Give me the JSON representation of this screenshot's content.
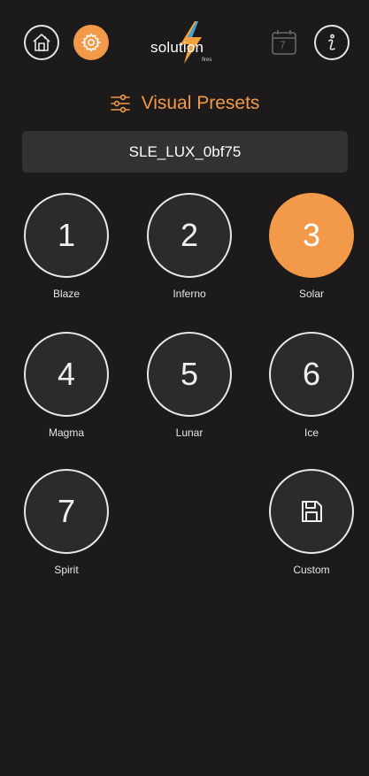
{
  "header": {
    "logo_text": "solution",
    "logo_sub": "fires",
    "icons": {
      "home": "home-icon",
      "settings": "gear-icon",
      "calendar": "calendar-icon",
      "info": "info-icon"
    },
    "calendar_day": "7"
  },
  "section": {
    "title": "Visual Presets",
    "icon": "sliders-icon"
  },
  "device": {
    "name": "SLE_LUX_0bf75"
  },
  "presets": [
    {
      "number": "1",
      "label": "Blaze",
      "active": false
    },
    {
      "number": "2",
      "label": "Inferno",
      "active": false
    },
    {
      "number": "3",
      "label": "Solar",
      "active": true
    },
    {
      "number": "4",
      "label": "Magma",
      "active": false
    },
    {
      "number": "5",
      "label": "Lunar",
      "active": false
    },
    {
      "number": "6",
      "label": "Ice",
      "active": false
    },
    {
      "number": "7",
      "label": "Spirit",
      "active": false
    }
  ],
  "custom": {
    "label": "Custom",
    "icon": "save-icon"
  },
  "colors": {
    "accent": "#f29a4a",
    "background": "#1c1a1a",
    "device_bar": "#333131"
  }
}
